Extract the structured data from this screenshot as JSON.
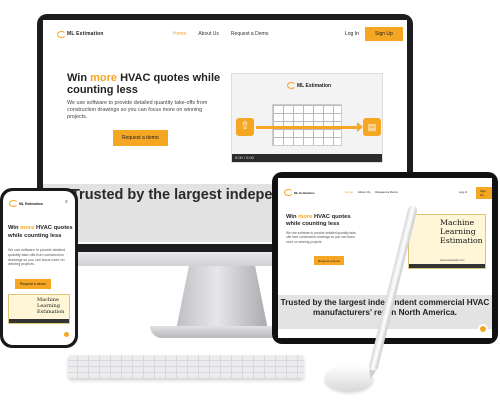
{
  "brand": {
    "logo_text": "ML Estimation",
    "accent_color": "#f5a623"
  },
  "monitor": {
    "nav": {
      "home": "Home",
      "about": "About Us",
      "demo": "Request a Demo",
      "login": "Log In",
      "signup": "Sign Up"
    },
    "hero": {
      "title_prefix": "Win ",
      "title_accent": "more",
      "title_rest": " HVAC quotes while counting less",
      "text": "We use software to provide detailed quantity take-offs from construction drawings so you can focus more on winning projects.",
      "button": "Request a demo"
    },
    "video": {
      "logo_text": "ML Estimation",
      "time": "0:00 / 0:00"
    },
    "band_title": "Trusted by the largest independent commercial HVAC manufacturers’ rep in North America."
  },
  "phone": {
    "logo_text": "ML Estimation",
    "menu_icon": "menu-icon",
    "title_prefix": "Win ",
    "title_accent": "more",
    "title_rest": " HVAC quotes while counting less",
    "text": "We use software to provide detailed quantity take-offs from construction drawings so you can focus more on winning projects.",
    "button": "Request a demo",
    "video_text": "Machine Learning Estimation"
  },
  "tablet": {
    "logo_text": "ML Estimation",
    "nav": {
      "home": "Home",
      "about": "About Us",
      "demo": "Request a Demo",
      "login": "Log In",
      "signup": "Sign Up"
    },
    "title_prefix": "Win ",
    "title_accent": "more",
    "title_rest": " HVAC quotes while counting less",
    "text": "We use software to provide detailed quantity take-offs from construction drawings so you can focus more on winning projects.",
    "button": "Request a demo",
    "video_text": "Machine Learning Estimation",
    "video_sub": "www.mlestimation.com",
    "band_title": "Trusted by the largest independent commercial HVAC manufacturers’ rep in North America."
  }
}
